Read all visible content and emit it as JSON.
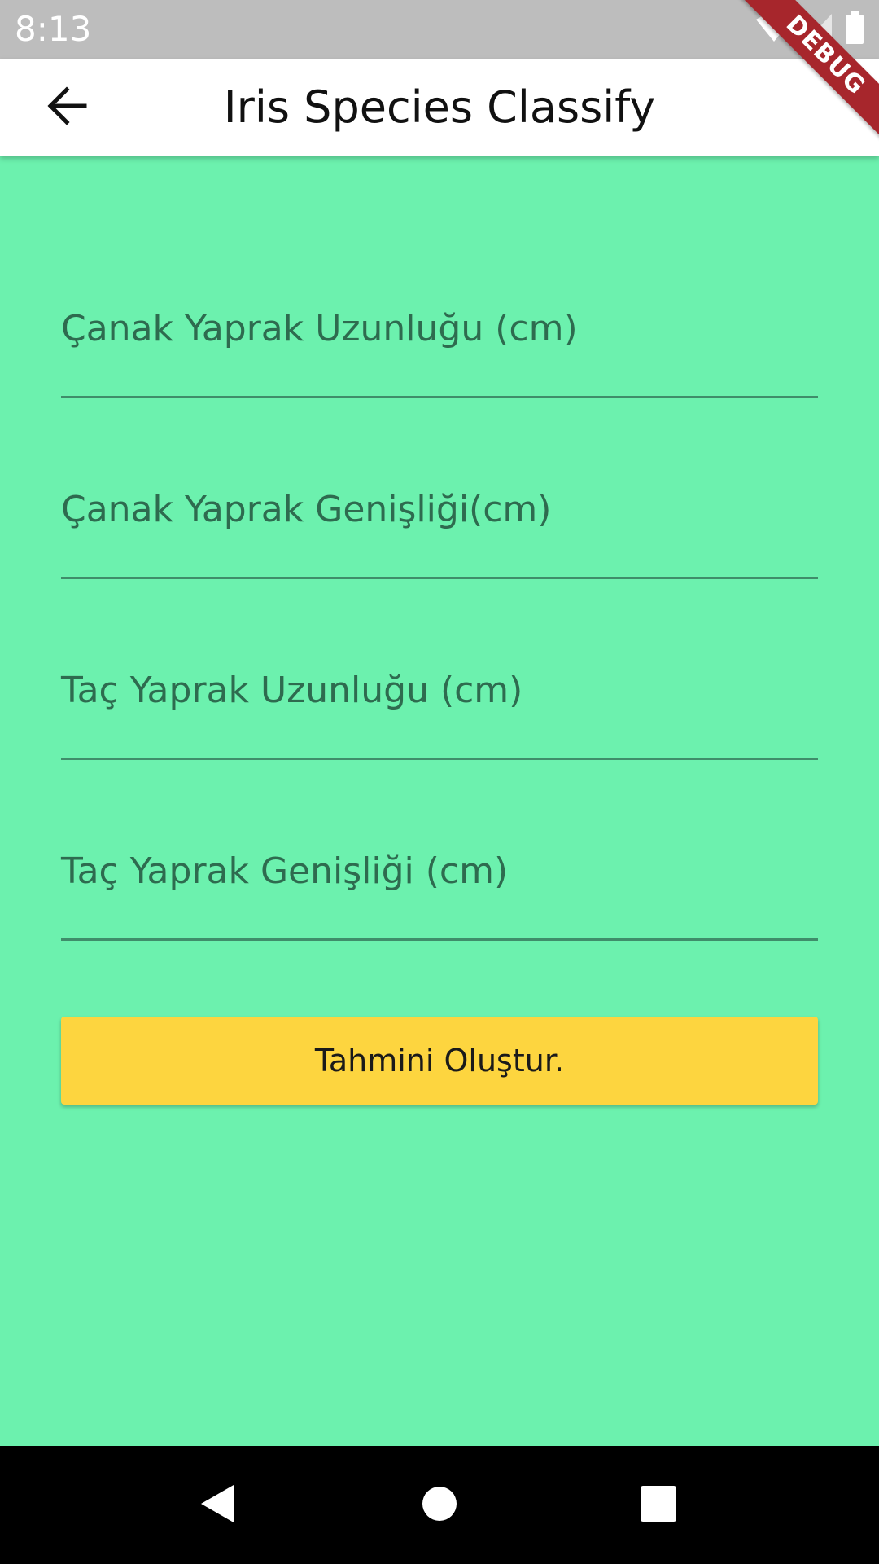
{
  "status_bar": {
    "time": "8:13",
    "icons": [
      "wifi-icon",
      "signal-icon",
      "battery-icon"
    ]
  },
  "debug_banner": "DEBUG",
  "app_bar": {
    "title": "Iris Species Classify",
    "back_icon": "arrow-back-icon"
  },
  "form": {
    "fields": [
      {
        "label": "Çanak Yaprak Uzunluğu (cm)",
        "value": ""
      },
      {
        "label": "Çanak Yaprak Genişliği(cm)",
        "value": ""
      },
      {
        "label": "Taç Yaprak Uzunluğu (cm)",
        "value": ""
      },
      {
        "label": "Taç Yaprak Genişliği (cm)",
        "value": ""
      }
    ],
    "submit_label": "Tahmini Oluştur."
  },
  "nav_bar": {
    "buttons": [
      "back-triangle-icon",
      "home-circle-icon",
      "recents-square-icon"
    ]
  },
  "colors": {
    "background": "#6cf1ae",
    "app_bar": "#ffffff",
    "button": "#fdd53f",
    "underline": "#3f8d6a",
    "label": "#2e6b4f",
    "debug_ribbon": "#a7262c",
    "status_bar": "#bdbdbd",
    "nav_bar": "#000000"
  }
}
